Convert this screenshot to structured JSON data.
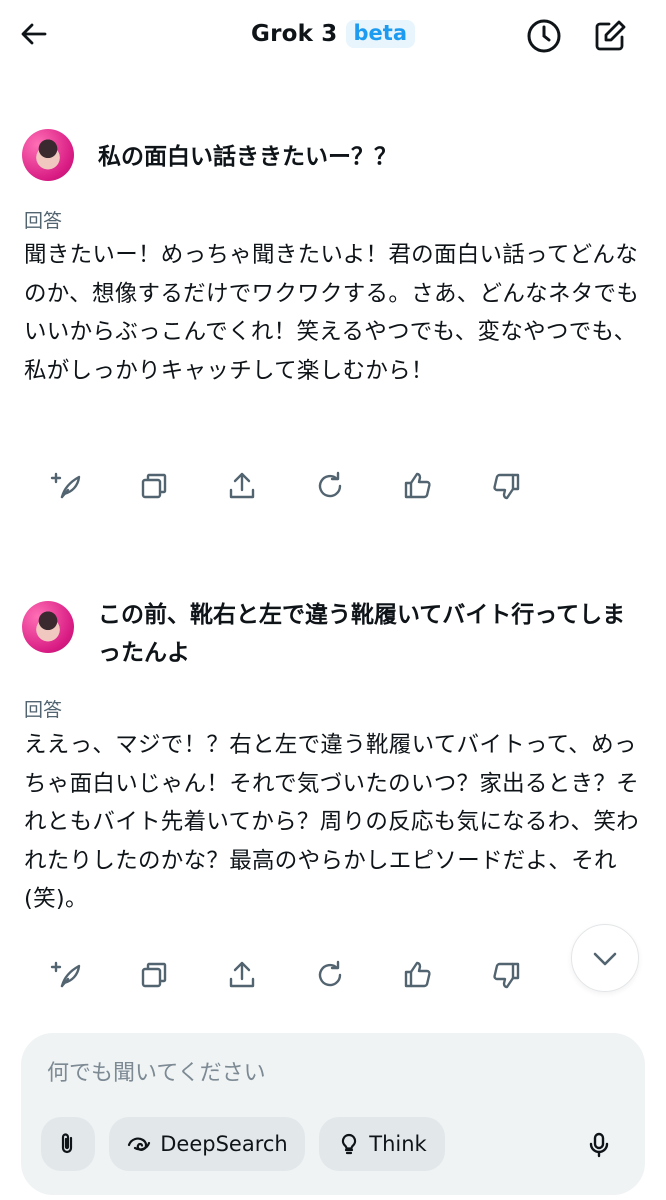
{
  "header": {
    "title": "Grok 3",
    "badge": "beta",
    "icons": {
      "back": "arrow-left-icon",
      "history": "clock-icon",
      "new_chat": "compose-icon"
    }
  },
  "messages": [
    {
      "user_text": "私の面白い話ききたいー？？",
      "answer_label": "回答",
      "answer_text": "聞きたいー！めっちゃ聞きたいよ！君の面白い話ってどんなのか、想像するだけでワクワクする。さあ、どんなネタでもいいからぶっこんでくれ！笑えるやつでも、変なやつでも、私がしっかりキャッチして楽しむから！"
    },
    {
      "user_text": "この前、靴右と左で違う靴履いてバイト行ってしまったんよ",
      "answer_label": "回答",
      "answer_text": "ええっ、マジで！？右と左で違う靴履いてバイトって、めっちゃ面白いじゃん！それで気づいたのいつ？家出るとき？それともバイト先着いてから？周りの反応も気になるわ、笑われたりしたのかな？最高のやらかしエピソードだよ、それ (笑)。"
    }
  ],
  "action_icons": [
    "regenerate-sparkle-icon",
    "copy-icon",
    "share-icon",
    "refresh-icon",
    "thumbs-up-icon",
    "thumbs-down-icon"
  ],
  "composer": {
    "placeholder": "何でも聞いてください",
    "deepsearch_label": "DeepSearch",
    "think_label": "Think",
    "icons": {
      "attach": "paperclip-icon",
      "deepsearch": "swirl-icon",
      "think": "lightbulb-icon",
      "mic": "microphone-icon"
    }
  },
  "colors": {
    "accent": "#1d9bf0",
    "text": "#0f1419",
    "muted": "#536471",
    "composer_bg": "#eff3f4"
  }
}
